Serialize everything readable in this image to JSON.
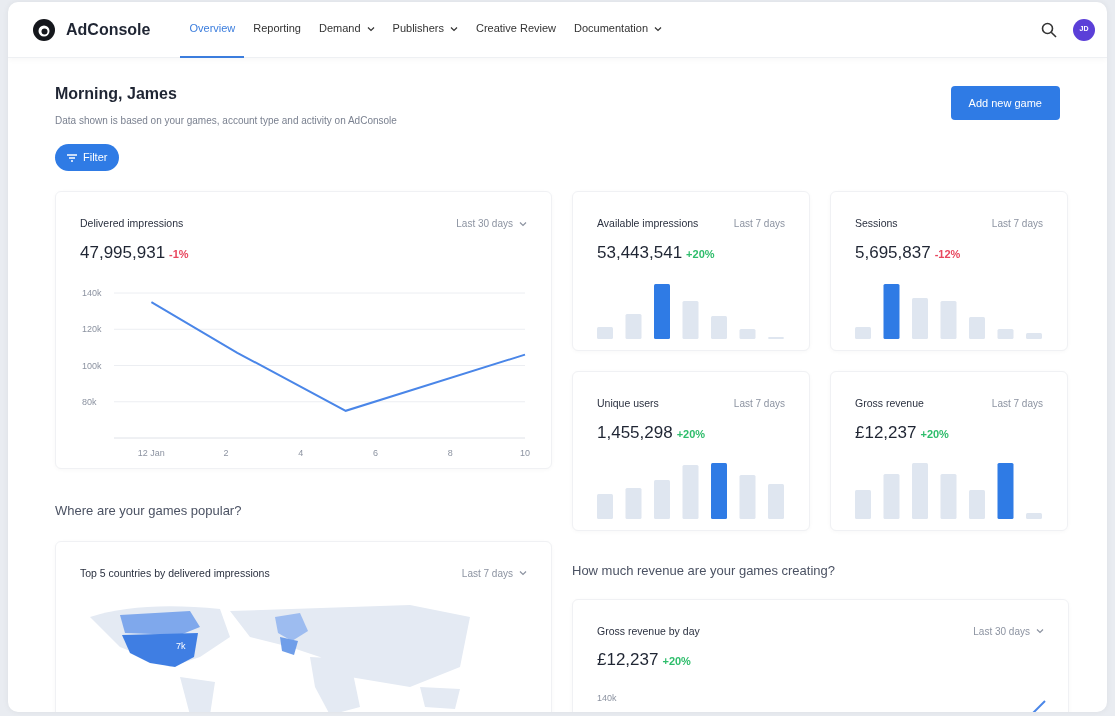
{
  "navbar": {
    "brand": "AdConsole",
    "links": [
      {
        "label": "Overview",
        "selected": true,
        "dropdown": false
      },
      {
        "label": "Reporting",
        "selected": false,
        "dropdown": false
      },
      {
        "label": "Demand",
        "selected": false,
        "dropdown": true
      },
      {
        "label": "Publishers",
        "selected": false,
        "dropdown": true
      },
      {
        "label": "Creative Review",
        "selected": false,
        "dropdown": false
      },
      {
        "label": "Documentation",
        "selected": false,
        "dropdown": true
      }
    ],
    "avatar": "JD"
  },
  "header": {
    "greeting": "Morning, James",
    "subtitle": "Data shown is based on your games, account type and activity on AdConsole",
    "add_button": "Add new game",
    "filter_button": "Filter"
  },
  "delivered": {
    "title": "Delivered impressions",
    "period": "Last 30 days",
    "period_dropdown": true,
    "value": "47,995,931",
    "change": "-1%",
    "color": "#e8475e",
    "chart_data": {
      "type": "line",
      "x": [
        0,
        2.3,
        5.2,
        10
      ],
      "series": [
        {
          "color": "#4a86e8",
          "values": [
            135000,
            107000,
            75000,
            106000
          ]
        }
      ],
      "grid": true,
      "xlim": [
        -1,
        10
      ],
      "ylim": [
        60000,
        140000
      ],
      "xticks": [
        {
          "value": 0,
          "label": "12 Jan"
        },
        2,
        4,
        6,
        8,
        10
      ],
      "yticks": [
        {
          "value": 80000,
          "label": "80k"
        },
        {
          "value": 100000,
          "label": "100k"
        },
        {
          "value": 120000,
          "label": "120k"
        },
        {
          "value": 140000,
          "label": "140k"
        }
      ]
    }
  },
  "stats": [
    {
      "title": "Available impressions",
      "period": "Last 7 days",
      "period_dropdown": false,
      "value": "53,443,541",
      "change": "+20%",
      "color": "#2ebd6b"
    },
    {
      "title": "Sessions",
      "period": "Last 7 days",
      "period_dropdown": false,
      "value": "5,695,837",
      "change": "-12%",
      "color": "#e8475e"
    },
    {
      "title": "Unique users",
      "period": "Last 7 days",
      "period_dropdown": false,
      "value": "1,455,298",
      "change": "+20%",
      "color": "#2ebd6b"
    },
    {
      "title": "Gross revenue",
      "period": "Last 7 days",
      "period_dropdown": false,
      "value": "£12,237",
      "change": "+20%",
      "color": "#2ebd6b"
    }
  ],
  "popular": {
    "heading": "Where are your games popular?",
    "card": {
      "title": "Top 5 countries by delivered impressions",
      "period": "Last 7 days",
      "period_dropdown": true,
      "map_label": "7k"
    }
  },
  "revenue": {
    "heading": "How much revenue are your games creating?",
    "card": {
      "title": "Gross revenue by day",
      "period": "Last 30 days",
      "period_dropdown": true,
      "value": "£12,237",
      "change": "+20%",
      "color": "#2ebd6b",
      "axis_label": "140k"
    }
  }
}
